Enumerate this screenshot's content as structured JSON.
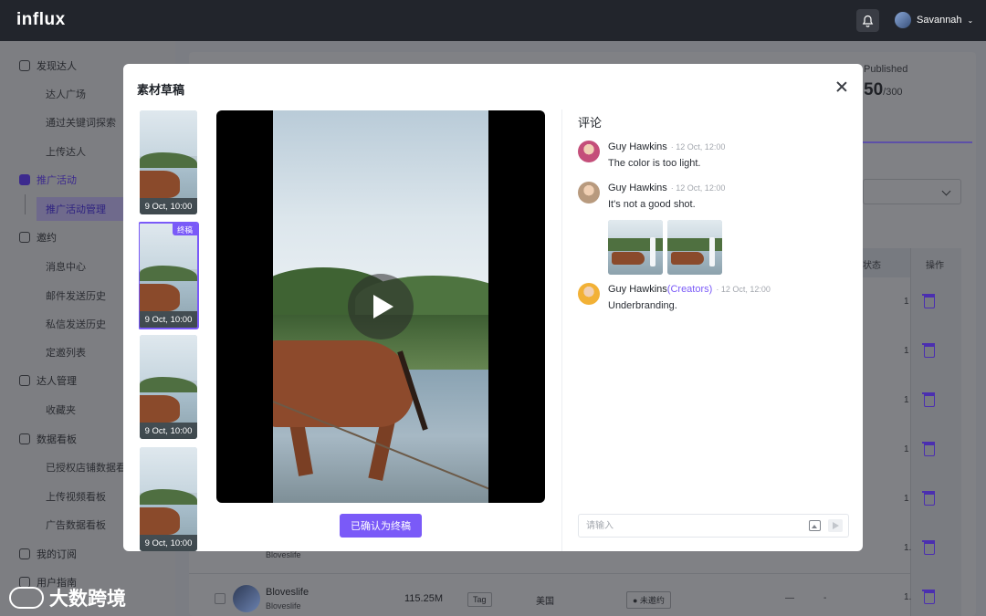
{
  "app": {
    "logo": "influx",
    "user_name": "Savannah"
  },
  "sidebar": {
    "items": [
      {
        "label": "发现达人",
        "type": "group"
      },
      {
        "label": "达人广场",
        "type": "sub"
      },
      {
        "label": "通过关键词探索",
        "type": "sub"
      },
      {
        "label": "上传达人",
        "type": "sub"
      },
      {
        "label": "推广活动",
        "type": "group",
        "active": true
      },
      {
        "label": "推广活动管理",
        "type": "sub",
        "selected": true
      },
      {
        "label": "邀约",
        "type": "group"
      },
      {
        "label": "消息中心",
        "type": "sub"
      },
      {
        "label": "邮件发送历史",
        "type": "sub"
      },
      {
        "label": "私信发送历史",
        "type": "sub"
      },
      {
        "label": "定邀列表",
        "type": "sub"
      },
      {
        "label": "达人管理",
        "type": "group"
      },
      {
        "label": "收藏夹",
        "type": "sub"
      },
      {
        "label": "数据看板",
        "type": "group"
      },
      {
        "label": "已授权店铺数据看板",
        "type": "sub"
      },
      {
        "label": "上传视频看板",
        "type": "sub"
      },
      {
        "label": "广告数据看板",
        "type": "sub"
      },
      {
        "label": "我的订阅",
        "type": "group"
      },
      {
        "label": "用户指南",
        "type": "group"
      }
    ],
    "watermark": "大数跨境"
  },
  "background": {
    "published_label": "Published",
    "published_count": "50",
    "published_total": "/300",
    "table_header_status": "状态",
    "table_header_action": "操作",
    "row_peek_handle": "Bloveslife",
    "row_numbers": [
      "1",
      "1",
      "1",
      "1",
      "1",
      "1.",
      "1."
    ],
    "last_row": {
      "name": "Bloveslife",
      "handle": "Bloveslife",
      "fans": "115.25M",
      "tag": "Tag",
      "country": "美国",
      "status": "● 未邀约",
      "dash1": "—",
      "dash2": "-"
    }
  },
  "modal": {
    "title": "素材草稿",
    "thumbnails": [
      {
        "time": "9 Oct, 10:00",
        "final": false
      },
      {
        "time": "9 Oct, 10:00",
        "final": true,
        "badge": "终稿"
      },
      {
        "time": "9 Oct, 10:00",
        "final": false
      },
      {
        "time": "9 Oct, 10:00",
        "final": false
      }
    ],
    "confirm_button": "已确认为终稿",
    "comments_title": "评论",
    "comments": [
      {
        "name": "Guy Hawkins",
        "creator": "",
        "time": "12 Oct, 12:00",
        "text": "The color is too light.",
        "avatar_color": "#c44f7a",
        "images": 0
      },
      {
        "name": "Guy Hawkins",
        "creator": "",
        "time": "12 Oct, 12:00",
        "text": "It's not a good shot.",
        "avatar_color": "#b89a7e",
        "images": 2
      },
      {
        "name": "Guy Hawkins",
        "creator": "(Creators)",
        "time": "12 Oct, 12:00",
        "text": "Underbranding.",
        "avatar_color": "#f2b136",
        "images": 0
      }
    ],
    "input_placeholder": "请输入"
  },
  "colors": {
    "accent": "#7a5af8",
    "topbar": "#22252c"
  }
}
